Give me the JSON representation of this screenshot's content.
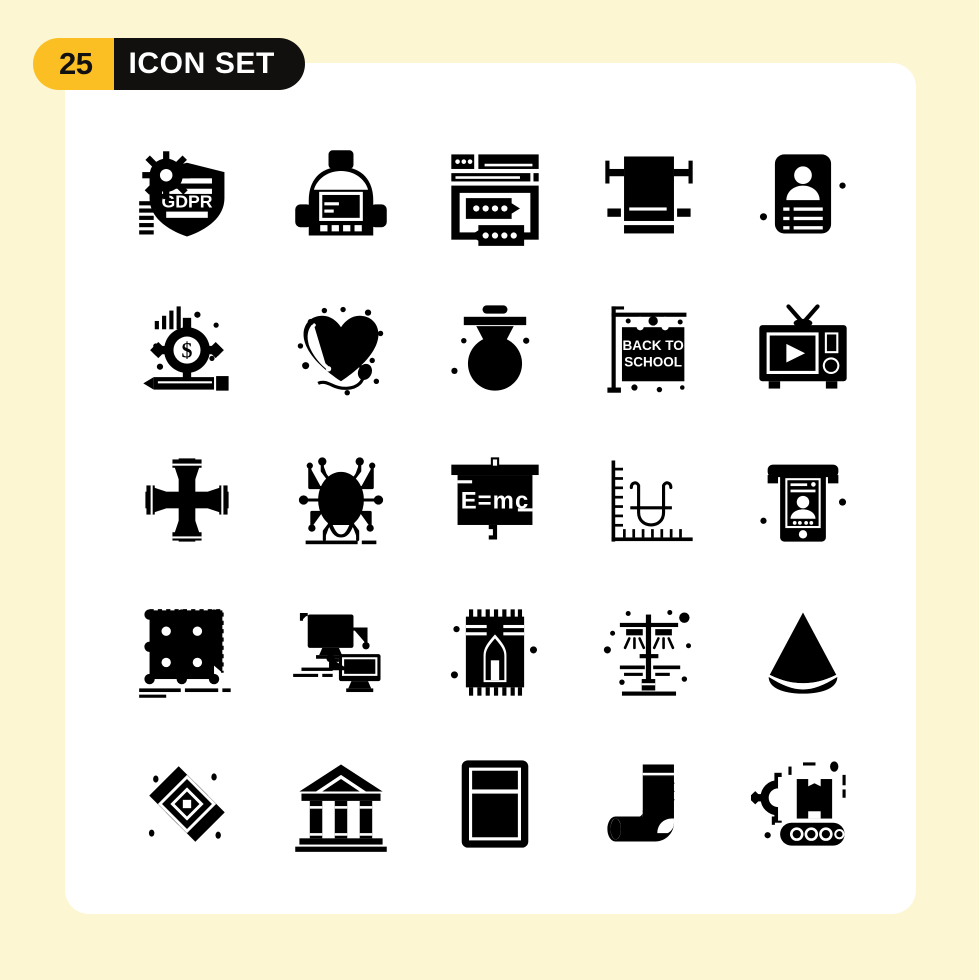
{
  "page": {
    "background_color": "#FCF6D2",
    "card_color": "#FFFFFF"
  },
  "header": {
    "count": "25",
    "title": "ICON SET",
    "count_bg": "#FBBF24",
    "count_fg": "#111111",
    "title_bg": "#12100E",
    "title_fg": "#FFFFFF"
  },
  "grid": {
    "columns": 5,
    "rows": 5,
    "total": 25,
    "style": "solid-glyph",
    "color": "#000000"
  },
  "icons": [
    {
      "index": 1,
      "name": "gdpr-shield-icon",
      "label": "GDPR Shield",
      "text": "GDPR",
      "row": 1,
      "col": 1
    },
    {
      "index": 2,
      "name": "backpack-icon",
      "label": "Backpack",
      "text": "",
      "row": 1,
      "col": 2
    },
    {
      "index": 3,
      "name": "web-chat-window-icon",
      "label": "Web Chat Window",
      "text": "",
      "row": 1,
      "col": 3
    },
    {
      "index": 4,
      "name": "window-blind-icon",
      "label": "Window Blind",
      "text": "",
      "row": 1,
      "col": 4
    },
    {
      "index": 5,
      "name": "id-card-profile-icon",
      "label": "ID Card Profile",
      "text": "",
      "row": 1,
      "col": 5
    },
    {
      "index": 6,
      "name": "content-monetization-icon",
      "label": "Content Monetization",
      "text": "$",
      "row": 2,
      "col": 1
    },
    {
      "index": 7,
      "name": "heart-stethoscope-icon",
      "label": "Heart Stethoscope",
      "text": "",
      "row": 2,
      "col": 2
    },
    {
      "index": 8,
      "name": "quality-medal-search-icon",
      "label": "Quality Medal Search",
      "text": "",
      "row": 2,
      "col": 3
    },
    {
      "index": 9,
      "name": "back-to-school-sign-icon",
      "label": "Back To School Sign",
      "text": "BACK TO SCHOOL",
      "row": 2,
      "col": 4
    },
    {
      "index": 10,
      "name": "retro-television-icon",
      "label": "Retro Television",
      "text": "",
      "row": 2,
      "col": 5
    },
    {
      "index": 11,
      "name": "lug-wrench-icon",
      "label": "Lug Wrench",
      "text": "",
      "row": 3,
      "col": 1
    },
    {
      "index": 12,
      "name": "circuit-bug-icon",
      "label": "Circuit Bug",
      "text": "",
      "row": 3,
      "col": 2
    },
    {
      "index": 13,
      "name": "physics-blackboard-icon",
      "label": "Physics Blackboard",
      "text": "E=mc",
      "row": 3,
      "col": 3
    },
    {
      "index": 14,
      "name": "parabola-graph-icon",
      "label": "Parabola Graph",
      "text": "",
      "row": 3,
      "col": 4
    },
    {
      "index": 15,
      "name": "atm-kiosk-icon",
      "label": "ATM Kiosk",
      "text": "",
      "row": 3,
      "col": 5
    },
    {
      "index": 16,
      "name": "neural-network-grid-icon",
      "label": "Neural Network Grid",
      "text": "",
      "row": 4,
      "col": 1
    },
    {
      "index": 17,
      "name": "connected-computers-icon",
      "label": "Connected Computers",
      "text": "",
      "row": 4,
      "col": 2
    },
    {
      "index": 18,
      "name": "prayer-rug-icon",
      "label": "Prayer Rug",
      "text": "",
      "row": 4,
      "col": 3
    },
    {
      "index": 19,
      "name": "street-lamp-icon",
      "label": "Street Lamp",
      "text": "",
      "row": 4,
      "col": 4
    },
    {
      "index": 20,
      "name": "watermelon-slice-icon",
      "label": "Watermelon Slice",
      "text": "",
      "row": 4,
      "col": 5
    },
    {
      "index": 21,
      "name": "layered-diamonds-icon",
      "label": "Layered Diamonds",
      "text": "",
      "row": 5,
      "col": 1
    },
    {
      "index": 22,
      "name": "bank-building-icon",
      "label": "Bank Building",
      "text": "",
      "row": 5,
      "col": 2
    },
    {
      "index": 23,
      "name": "refrigerator-icon",
      "label": "Refrigerator",
      "text": "",
      "row": 5,
      "col": 3
    },
    {
      "index": 24,
      "name": "sock-icon",
      "label": "Sock",
      "text": "",
      "row": 5,
      "col": 4
    },
    {
      "index": 25,
      "name": "conveyor-gear-icon",
      "label": "Conveyor Gear",
      "text": "",
      "row": 5,
      "col": 5
    }
  ]
}
